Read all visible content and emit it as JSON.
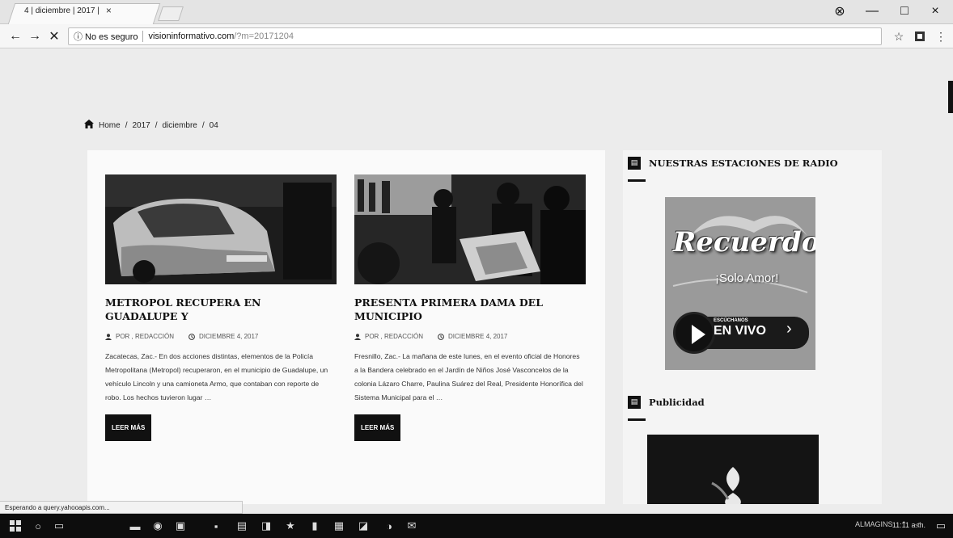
{
  "browser": {
    "tab_title": "4 | diciembre | 2017 |",
    "tab_close": "×",
    "window_controls": {
      "account": "⊗",
      "minimize": "—",
      "maximize": "□",
      "close": "×"
    },
    "nav": {
      "back": "←",
      "forward": "→",
      "reload": "✕"
    },
    "security_label": "ⓘ No es seguro",
    "url_host": "visioninformativo.com",
    "url_path": "/?m=20171204",
    "bookmark_star": "☆",
    "menu_dots": "⋮"
  },
  "breadcrumb": {
    "home": "Home",
    "sep": "/",
    "year": "2017",
    "month": "diciembre",
    "day": "04"
  },
  "posts": [
    {
      "title": "METROPOL RECUPERA EN GUADALUPE Y",
      "author": "POR , REDACCIÓN",
      "date": "DICIEMBRE 4, 2017",
      "excerpt": "Zacatecas, Zac.- En dos acciones distintas, elementos de la Policía Metropolitana (Metropol) recuperaron, en el municipio de Guadalupe, un vehículo Lincoln y una camioneta Armo, que contaban con reporte de robo. Los hechos tuvieron lugar …",
      "button": "LEER MÁS"
    },
    {
      "title": "PRESENTA PRIMERA DAMA DEL MUNICIPIO",
      "author": "POR , REDACCIÓN",
      "date": "DICIEMBRE 4, 2017",
      "excerpt": "Fresnillo, Zac.- La mañana de este lunes, en el evento oficial de Honores a la Bandera celebrado en el Jardín de Niños José Vasconcelos de la colonia Lázaro Charre, Paulina Suárez del Real, Presidente Honorífica del Sistema Municipal para el …",
      "button": "LEER MÁS"
    }
  ],
  "sidebar": {
    "radio_widget_title": "NUESTRAS ESTACIONES DE RADIO",
    "radio_brand": "Recuerdo",
    "radio_tagline": "¡Solo Amor!",
    "radio_listen_small": "ESCÚCHANOS",
    "radio_listen_big": "EN VIVO",
    "ads_widget_title": "Publicidad"
  },
  "statusbar": {
    "text": "Esperando a query.yahooapis.com..."
  },
  "taskbar": {
    "tray_text": "ALMAGINS",
    "clock": "11:11 a.m."
  }
}
